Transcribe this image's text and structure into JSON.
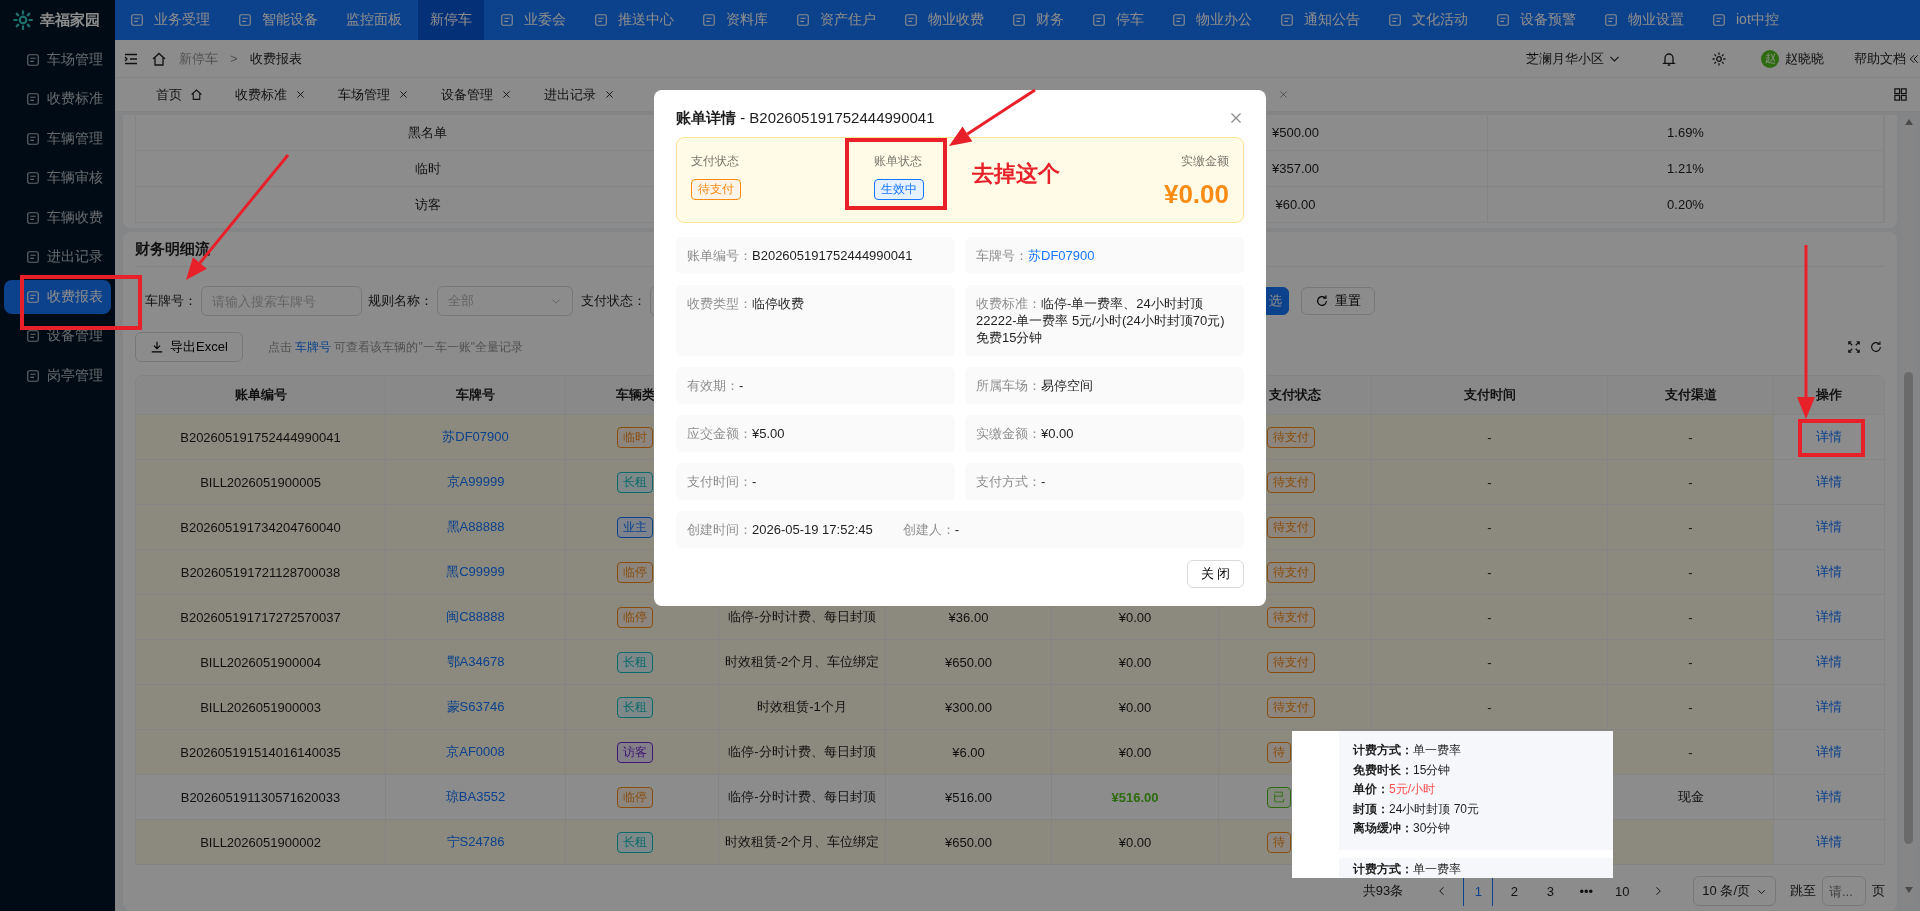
{
  "brand": {
    "name": "幸福家园"
  },
  "top_nav": [
    {
      "label": "业务受理",
      "kind": "icon",
      "selected": false
    },
    {
      "label": "智能设备",
      "kind": "icon",
      "selected": false
    },
    {
      "label": "监控面板",
      "kind": "plain",
      "selected": false
    },
    {
      "label": "新停车",
      "kind": "plain",
      "selected": true
    },
    {
      "label": "业委会",
      "kind": "icon",
      "selected": false
    },
    {
      "label": "推送中心",
      "kind": "icon",
      "selected": false
    },
    {
      "label": "资料库",
      "kind": "icon",
      "selected": false
    },
    {
      "label": "资产住户",
      "kind": "icon",
      "selected": false
    },
    {
      "label": "物业收费",
      "kind": "icon",
      "selected": false
    },
    {
      "label": "财务",
      "kind": "icon",
      "selected": false
    },
    {
      "label": "停车",
      "kind": "icon",
      "selected": false
    },
    {
      "label": "物业办公",
      "kind": "icon",
      "selected": false
    },
    {
      "label": "通知公告",
      "kind": "icon",
      "selected": false
    },
    {
      "label": "文化活动",
      "kind": "icon",
      "selected": false
    },
    {
      "label": "设备预警",
      "kind": "icon",
      "selected": false
    },
    {
      "label": "物业设置",
      "kind": "icon",
      "selected": false
    },
    {
      "label": "iot中控",
      "kind": "icon",
      "selected": false
    }
  ],
  "sidebar": {
    "items": [
      {
        "label": "车场管理",
        "selected": false
      },
      {
        "label": "收费标准",
        "selected": false
      },
      {
        "label": "车辆管理",
        "selected": false
      },
      {
        "label": "车辆审核",
        "selected": false
      },
      {
        "label": "车辆收费",
        "selected": false
      },
      {
        "label": "进出记录",
        "selected": false
      },
      {
        "label": "收费报表",
        "selected": true
      },
      {
        "label": "设备管理",
        "selected": false
      },
      {
        "label": "岗亭管理",
        "selected": false
      }
    ]
  },
  "breadcrumb": {
    "items": [
      "新停车",
      "收费报表"
    ],
    "separator": ">"
  },
  "header_right": {
    "community": "芝澜月华小区",
    "user_initial": "赵",
    "user_name": "赵晓晓",
    "help": "帮助文档"
  },
  "tabs": [
    {
      "label": "首页",
      "kind": "home",
      "selected": false
    },
    {
      "label": "收费标准",
      "kind": "closable",
      "selected": false
    },
    {
      "label": "车场管理",
      "kind": "closable",
      "selected": false
    },
    {
      "label": "设备管理",
      "kind": "closable",
      "selected": false
    },
    {
      "label": "进出记录",
      "kind": "closable",
      "selected": false
    }
  ],
  "summary_table": {
    "rows": [
      {
        "type": "黑名单",
        "amount": "¥500.00",
        "share": "1.69%"
      },
      {
        "type": "临时",
        "amount": "¥357.00",
        "share": "1.21%"
      },
      {
        "type": "访客",
        "amount": "¥60.00",
        "share": "0.20%"
      }
    ]
  },
  "ledger": {
    "title": "财务明细流",
    "filters": [
      {
        "label": "车牌号：",
        "kind": "input",
        "placeholder": "请输入搜索车牌号"
      },
      {
        "label": "规则名称：",
        "kind": "select",
        "value": "全部"
      },
      {
        "label": "支付状态：",
        "kind": "select"
      }
    ],
    "search_button": "选",
    "reset_button": "重置",
    "export_button": "导出Excel",
    "hint": {
      "before": "点击 ",
      "link": "车牌号",
      "after": " 可查看该车辆的\"一车一账\"全量记录"
    },
    "columns": [
      {
        "label": "账单编号"
      },
      {
        "label": "车牌号"
      },
      {
        "label": "车辆类"
      },
      {},
      {},
      {},
      {
        "label": "支付状态"
      },
      {
        "label": "支付时间"
      },
      {
        "label": "支付渠道"
      },
      {
        "label": "操作"
      }
    ],
    "rows": [
      {
        "bill_no": "B202605191752444990041",
        "plate": "苏DF07900",
        "vehicle_type": {
          "label": "临时",
          "kind": "temporary"
        },
        "status": "待支付",
        "paid_status": false,
        "pay_time": "-",
        "channel": "-",
        "action": "详情"
      },
      {
        "bill_no": "BILL2026051900005",
        "plate": "京A99999",
        "vehicle_type": {
          "label": "长租",
          "kind": "long_term"
        },
        "status": "待支付",
        "paid_status": false,
        "pay_time": "-",
        "channel": "-",
        "action": "详情"
      },
      {
        "bill_no": "B202605191734204760040",
        "plate": "黑A88888",
        "vehicle_type": {
          "label": "业主",
          "kind": "owner"
        },
        "status": "待支付",
        "paid_status": false,
        "pay_time": "-",
        "channel": "-",
        "action": "详情"
      },
      {
        "bill_no": "B202605191721128700038",
        "plate": "黑C99999",
        "vehicle_type": {
          "label": "临停",
          "kind": "temporary"
        },
        "status": "待支付",
        "paid_status": false,
        "pay_time": "-",
        "channel": "-",
        "action": "详情"
      },
      {
        "bill_no": "B202605191717272570037",
        "plate": "闽C88888",
        "vehicle_type": {
          "label": "临停",
          "kind": "temporary"
        },
        "rule": "临停-分时计费、每日封顶",
        "due": "¥36.00",
        "paid": "¥0.00",
        "status": "待支付",
        "paid_status": false,
        "pay_time": "-",
        "channel": "-",
        "action": "详情"
      },
      {
        "bill_no": "BILL2026051900004",
        "plate": "鄂A34678",
        "vehicle_type": {
          "label": "长租",
          "kind": "long_term"
        },
        "rule": "时效租赁-2个月、车位绑定",
        "due": "¥650.00",
        "paid": "¥0.00",
        "status": "待支付",
        "paid_status": false,
        "pay_time": "-",
        "channel": "-",
        "action": "详情"
      },
      {
        "bill_no": "BILL2026051900003",
        "plate": "蒙S63746",
        "vehicle_type": {
          "label": "长租",
          "kind": "long_term"
        },
        "rule": "时效租赁-1个月",
        "due": "¥300.00",
        "paid": "¥0.00",
        "status": "待支付",
        "paid_status": false,
        "pay_time": "-",
        "channel": "-",
        "action": "详情"
      },
      {
        "bill_no": "B202605191514016140035",
        "plate": "京AF0008",
        "vehicle_type": {
          "label": "访客",
          "kind": "visitor"
        },
        "rule": "临停-分时计费、每日封顶",
        "due": "¥6.00",
        "paid": "¥0.00",
        "status": "待",
        "paid_status": false,
        "channel": "-",
        "action": "详情"
      },
      {
        "bill_no": "B202605191130571620033",
        "plate": "琼BA3552",
        "vehicle_type": {
          "label": "临停",
          "kind": "temporary"
        },
        "rule": "临停-分时计费、每日封顶",
        "due": "¥516.00",
        "paid": "¥516.00",
        "status": "已",
        "paid_status": true,
        "channel": "现金",
        "action": "详情"
      },
      {
        "bill_no": "BILL2026051900002",
        "plate": "宁S24786",
        "vehicle_type": {
          "label": "长租",
          "kind": "long_term"
        },
        "rule": "时效租赁-2个月、车位绑定",
        "due": "¥650.00",
        "paid": "¥0.00",
        "status": "待",
        "paid_status": false,
        "action": "详情"
      }
    ]
  },
  "pagination": {
    "total": "共93条",
    "pages": [
      {
        "label": "1",
        "selected": true
      },
      {
        "label": "2",
        "selected": false
      },
      {
        "label": "3",
        "selected": false
      },
      {
        "label": "•••",
        "selected": false
      },
      {
        "label": "10",
        "selected": false
      }
    ],
    "page_size": "10 条/页",
    "jump_label": "跳至",
    "jump_placeholder": "请...",
    "jump_suffix": "页"
  },
  "modal": {
    "title": "**账单详情** - B202605191752444990041",
    "status_items": [
      {
        "label": "支付状态",
        "tag": "待支付",
        "color": "#fa8c16"
      },
      {
        "label": "账单状态",
        "tag": "生效中",
        "color": "#1677ff"
      }
    ],
    "amount": {
      "label": "实缴金额",
      "value": "¥0.00"
    },
    "fields": [
      {
        "label": "账单编号：",
        "value": "B202605191752444990041",
        "kind": "text"
      },
      {
        "label": "车牌号：",
        "value": "苏DF07900",
        "kind": "link"
      },
      {
        "label": "收费类型：",
        "value": "临停收费",
        "kind": "text"
      },
      {
        "label": "收费标准：",
        "value": "临停-单一费率、24小时封顶22222-单一费率 5元/小时(24小时封顶70元) 免费15分钟",
        "kind": "text"
      },
      {
        "label": "有效期：",
        "value": "-",
        "kind": "text"
      },
      {
        "label": "所属车场：",
        "value": "易停空间",
        "kind": "text"
      },
      {
        "label": "应交金额：",
        "value": "¥5.00",
        "kind": "text"
      },
      {
        "label": "实缴金额：",
        "value": "¥0.00",
        "kind": "text"
      },
      {
        "label": "支付时间：",
        "value": "-",
        "kind": "text"
      },
      {
        "label": "支付方式：",
        "value": "-",
        "kind": "text"
      }
    ],
    "footer_fields": [
      {
        "label": "创建时间：",
        "value": "2026-05-19 17:52:45"
      },
      {
        "label": "创建人：",
        "value": "-"
      }
    ],
    "close_button": "关 闭"
  },
  "rate_popup": {
    "cards": [
      {
        "lines": [
          {
            "label": "计费方式：",
            "value": "单一费率",
            "highlight": false
          },
          {
            "label": "免费时长：",
            "value": "15分钟",
            "highlight": false
          },
          {
            "label": "单价：",
            "value": "5元/小时",
            "highlight": true
          },
          {
            "label": "封顶：",
            "value": "24小时封顶 70元",
            "highlight": false
          },
          {
            "label": "离场缓冲：",
            "value": "30分钟",
            "highlight": false
          }
        ]
      },
      {
        "lines": [
          {
            "label": "计费方式：",
            "value": "单一费率",
            "highlight": false
          }
        ]
      }
    ]
  },
  "annotation": {
    "note": "去掉这个"
  }
}
